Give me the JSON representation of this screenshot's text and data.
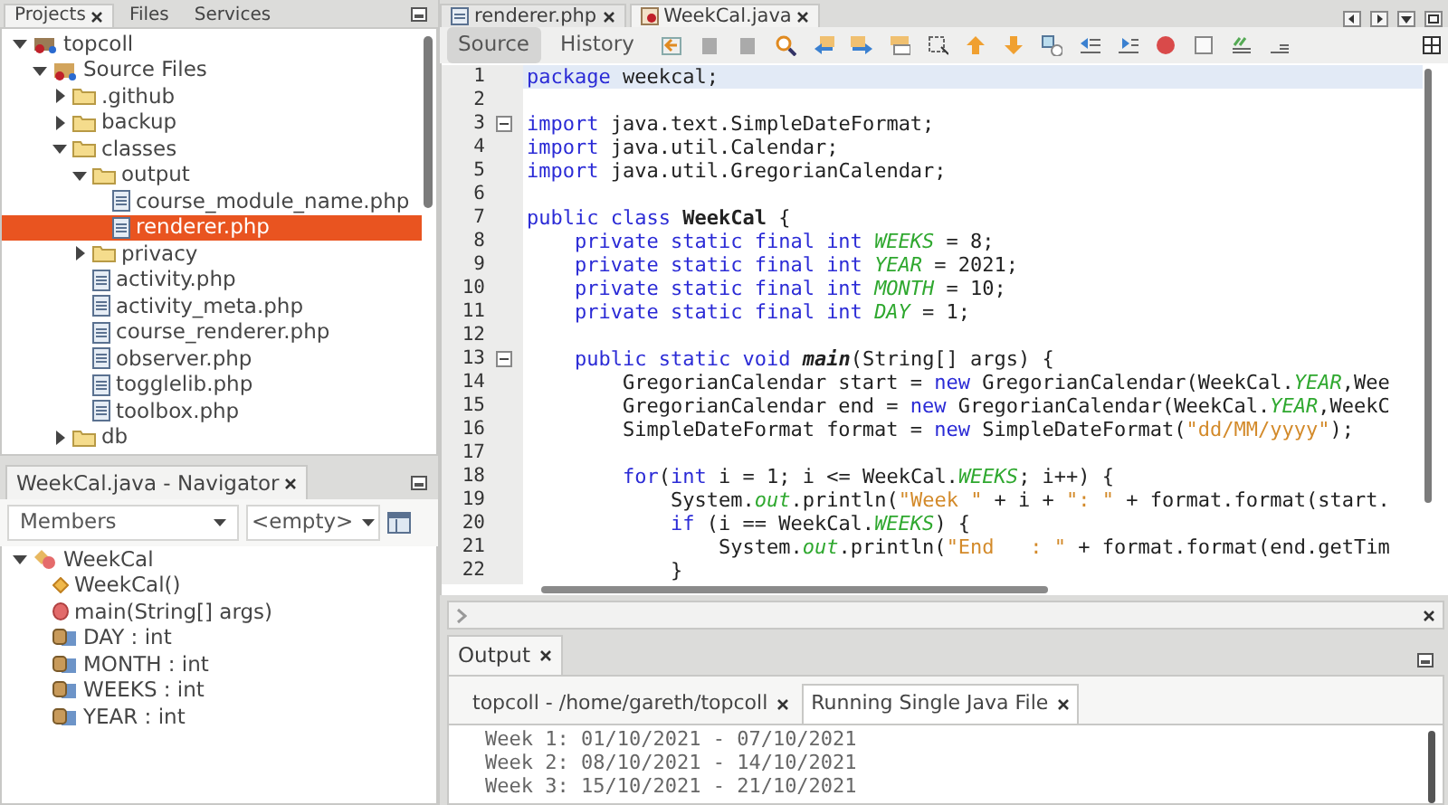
{
  "projects_panel": {
    "tabs": [
      {
        "label": "Projects",
        "selected": true
      },
      {
        "label": "Files",
        "selected": false
      },
      {
        "label": "Services",
        "selected": false
      }
    ],
    "tree": [
      {
        "label": "topcoll",
        "kind": "project",
        "expanded": true,
        "selected": false,
        "children": [
          {
            "label": "Source Files",
            "kind": "source",
            "expanded": true,
            "selected": false,
            "children": [
              {
                "label": ".github",
                "kind": "folder",
                "expanded": false,
                "selected": false
              },
              {
                "label": "backup",
                "kind": "folder",
                "expanded": false,
                "selected": false
              },
              {
                "label": "classes",
                "kind": "folder",
                "expanded": true,
                "selected": false,
                "children": [
                  {
                    "label": "output",
                    "kind": "folder",
                    "expanded": true,
                    "selected": false,
                    "children": [
                      {
                        "label": "course_module_name.php",
                        "kind": "file",
                        "selected": false
                      },
                      {
                        "label": "renderer.php",
                        "kind": "file",
                        "selected": true
                      }
                    ]
                  },
                  {
                    "label": "privacy",
                    "kind": "folder",
                    "expanded": false,
                    "selected": false
                  },
                  {
                    "label": "activity.php",
                    "kind": "file",
                    "selected": false
                  },
                  {
                    "label": "activity_meta.php",
                    "kind": "file",
                    "selected": false
                  },
                  {
                    "label": "course_renderer.php",
                    "kind": "file",
                    "selected": false
                  },
                  {
                    "label": "observer.php",
                    "kind": "file",
                    "selected": false
                  },
                  {
                    "label": "togglelib.php",
                    "kind": "file",
                    "selected": false
                  },
                  {
                    "label": "toolbox.php",
                    "kind": "file",
                    "selected": false
                  }
                ]
              },
              {
                "label": "db",
                "kind": "folder",
                "expanded": false,
                "selected": false
              }
            ]
          }
        ]
      }
    ]
  },
  "navigator": {
    "title": "WeekCal.java - Navigator",
    "filter": "Members",
    "scope": "<empty>",
    "tree": [
      {
        "label": "WeekCal",
        "kind": "class",
        "expanded": true,
        "selected": false,
        "children": [
          {
            "label": "WeekCal()",
            "kind": "constructor",
            "selected": false
          },
          {
            "label": "main(String[] args)",
            "kind": "method",
            "selected": false
          },
          {
            "label": "DAY : int",
            "kind": "field",
            "selected": false
          },
          {
            "label": "MONTH : int",
            "kind": "field",
            "selected": false
          },
          {
            "label": "WEEKS : int",
            "kind": "field",
            "selected": false
          },
          {
            "label": "YEAR : int",
            "kind": "field",
            "selected": false
          }
        ]
      }
    ]
  },
  "editor": {
    "tabs": [
      {
        "label": "renderer.php",
        "kind": "php",
        "selected": false
      },
      {
        "label": "WeekCal.java",
        "kind": "java",
        "selected": true
      }
    ],
    "views": [
      {
        "label": "Source",
        "selected": true
      },
      {
        "label": "History",
        "selected": false
      }
    ],
    "lines": [
      {
        "number": "1",
        "current": true,
        "fold": false,
        "tokens": [
          {
            "kind": "kw",
            "text": "package"
          },
          {
            "kind": "plain",
            "text": " weekcal;"
          }
        ]
      },
      {
        "number": "2",
        "current": false,
        "fold": false
      },
      {
        "number": "3",
        "current": false,
        "fold": true,
        "tokens": [
          {
            "kind": "kw",
            "text": "import"
          },
          {
            "kind": "plain",
            "text": " java.text.SimpleDateFormat;"
          }
        ]
      },
      {
        "number": "4",
        "current": false,
        "fold": false,
        "tokens": [
          {
            "kind": "kw",
            "text": "import"
          },
          {
            "kind": "plain",
            "text": " java.util.Calendar;"
          }
        ]
      },
      {
        "number": "5",
        "current": false,
        "fold": false,
        "tokens": [
          {
            "kind": "kw",
            "text": "import"
          },
          {
            "kind": "plain",
            "text": " java.util.GregorianCalendar;"
          }
        ]
      },
      {
        "number": "6",
        "current": false,
        "fold": false
      },
      {
        "number": "7",
        "current": false,
        "fold": false,
        "tokens": [
          {
            "kind": "kw",
            "text": "public class "
          },
          {
            "kind": "cls",
            "text": "WeekCal"
          },
          {
            "kind": "plain",
            "text": " {"
          }
        ]
      },
      {
        "number": "8",
        "current": false,
        "fold": false,
        "tokens": [
          {
            "kind": "kw",
            "text": "    private static final int "
          },
          {
            "kind": "const",
            "text": "WEEKS"
          },
          {
            "kind": "plain",
            "text": " = 8;"
          }
        ]
      },
      {
        "number": "9",
        "current": false,
        "fold": false,
        "tokens": [
          {
            "kind": "kw",
            "text": "    private static final int "
          },
          {
            "kind": "const",
            "text": "YEAR"
          },
          {
            "kind": "plain",
            "text": " = 2021;"
          }
        ]
      },
      {
        "number": "10",
        "current": false,
        "fold": false,
        "tokens": [
          {
            "kind": "kw",
            "text": "    private static final int "
          },
          {
            "kind": "const",
            "text": "MONTH"
          },
          {
            "kind": "plain",
            "text": " = 10;"
          }
        ]
      },
      {
        "number": "11",
        "current": false,
        "fold": false,
        "tokens": [
          {
            "kind": "kw",
            "text": "    private static final int "
          },
          {
            "kind": "const",
            "text": "DAY"
          },
          {
            "kind": "plain",
            "text": " = 1;"
          }
        ]
      },
      {
        "number": "12",
        "current": false,
        "fold": false
      },
      {
        "number": "13",
        "current": false,
        "fold": true,
        "tokens": [
          {
            "kind": "kw",
            "text": "    public static void "
          },
          {
            "kind": "method",
            "text": "main"
          },
          {
            "kind": "plain",
            "text": "(String[] args) {"
          }
        ]
      },
      {
        "number": "14",
        "current": false,
        "fold": false,
        "tokens": [
          {
            "kind": "plain",
            "text": "        GregorianCalendar start = "
          },
          {
            "kind": "kw",
            "text": "new"
          },
          {
            "kind": "plain",
            "text": " GregorianCalendar(WeekCal."
          },
          {
            "kind": "const",
            "text": "YEAR"
          },
          {
            "kind": "plain",
            "text": ",Wee"
          }
        ]
      },
      {
        "number": "15",
        "current": false,
        "fold": false,
        "tokens": [
          {
            "kind": "plain",
            "text": "        GregorianCalendar end = "
          },
          {
            "kind": "kw",
            "text": "new"
          },
          {
            "kind": "plain",
            "text": " GregorianCalendar(WeekCal."
          },
          {
            "kind": "const",
            "text": "YEAR"
          },
          {
            "kind": "plain",
            "text": ",WeekC"
          }
        ]
      },
      {
        "number": "16",
        "current": false,
        "fold": false,
        "tokens": [
          {
            "kind": "plain",
            "text": "        SimpleDateFormat format = "
          },
          {
            "kind": "kw",
            "text": "new"
          },
          {
            "kind": "plain",
            "text": " SimpleDateFormat("
          },
          {
            "kind": "str",
            "text": "\"dd/MM/yyyy\""
          },
          {
            "kind": "plain",
            "text": ");"
          }
        ]
      },
      {
        "number": "17",
        "current": false,
        "fold": false
      },
      {
        "number": "18",
        "current": false,
        "fold": false,
        "tokens": [
          {
            "kind": "kw",
            "text": "        for"
          },
          {
            "kind": "plain",
            "text": "("
          },
          {
            "kind": "kw",
            "text": "int"
          },
          {
            "kind": "plain",
            "text": " i = 1; i <= WeekCal."
          },
          {
            "kind": "const",
            "text": "WEEKS"
          },
          {
            "kind": "plain",
            "text": "; i++) {"
          }
        ]
      },
      {
        "number": "19",
        "current": false,
        "fold": false,
        "tokens": [
          {
            "kind": "plain",
            "text": "            System."
          },
          {
            "kind": "const",
            "text": "out"
          },
          {
            "kind": "plain",
            "text": ".println("
          },
          {
            "kind": "str",
            "text": "\"Week \""
          },
          {
            "kind": "plain",
            "text": " + i + "
          },
          {
            "kind": "str",
            "text": "\": \""
          },
          {
            "kind": "plain",
            "text": " + format.format(start."
          }
        ]
      },
      {
        "number": "20",
        "current": false,
        "fold": false,
        "tokens": [
          {
            "kind": "kw",
            "text": "            if"
          },
          {
            "kind": "plain",
            "text": " (i == WeekCal."
          },
          {
            "kind": "const",
            "text": "WEEKS"
          },
          {
            "kind": "plain",
            "text": ") {"
          }
        ]
      },
      {
        "number": "21",
        "current": false,
        "fold": false,
        "tokens": [
          {
            "kind": "plain",
            "text": "                System."
          },
          {
            "kind": "const",
            "text": "out"
          },
          {
            "kind": "plain",
            "text": ".println("
          },
          {
            "kind": "str",
            "text": "\"End   : \""
          },
          {
            "kind": "plain",
            "text": " + format.format(end.getTim"
          }
        ]
      },
      {
        "number": "22",
        "current": false,
        "fold": false,
        "tokens": [
          {
            "kind": "plain",
            "text": "            }"
          }
        ]
      }
    ]
  },
  "output": {
    "title": "Output",
    "tabs": [
      {
        "label": "topcoll - /home/gareth/topcoll",
        "selected": false
      },
      {
        "label": "Running Single Java File",
        "selected": true
      }
    ],
    "lines": [
      "Week 1: 01/10/2021 - 07/10/2021",
      "Week 2: 08/10/2021 - 14/10/2021",
      "Week 3: 15/10/2021 - 21/10/2021"
    ]
  }
}
